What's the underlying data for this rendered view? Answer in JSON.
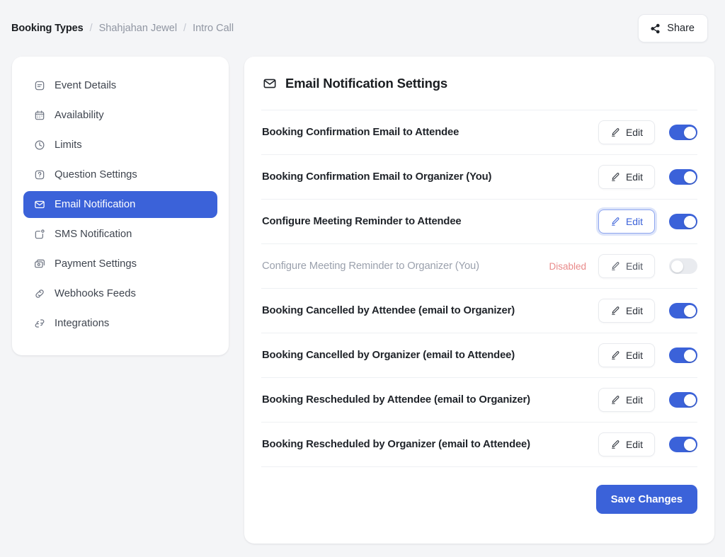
{
  "breadcrumb": {
    "root": "Booking Types",
    "separator": "/",
    "owner": "Shahjahan Jewel",
    "current": "Intro Call"
  },
  "topbar": {
    "share_label": "Share",
    "share_icon": "share-network-icon"
  },
  "sidebar": {
    "items": [
      {
        "label": "Event Details",
        "icon": "event-details-icon",
        "active": false
      },
      {
        "label": "Availability",
        "icon": "calendar-icon",
        "active": false
      },
      {
        "label": "Limits",
        "icon": "clock-icon",
        "active": false
      },
      {
        "label": "Question Settings",
        "icon": "question-square-icon",
        "active": false
      },
      {
        "label": "Email Notification",
        "icon": "envelope-icon",
        "active": true
      },
      {
        "label": "SMS Notification",
        "icon": "sms-bubble-icon",
        "active": false
      },
      {
        "label": "Payment Settings",
        "icon": "payment-card-icon",
        "active": false
      },
      {
        "label": "Webhooks Feeds",
        "icon": "link-icon",
        "active": false
      },
      {
        "label": "Integrations",
        "icon": "integrations-icon",
        "active": false
      }
    ]
  },
  "main": {
    "title": "Email Notification Settings",
    "title_icon": "envelope-icon",
    "edit_label": "Edit",
    "edit_icon": "pencil-icon",
    "disabled_label": "Disabled",
    "save_label": "Save Changes",
    "rows": [
      {
        "label": "Booking Confirmation Email to Attendee",
        "enabled": true,
        "focused": false,
        "disabled": false
      },
      {
        "label": "Booking Confirmation Email to Organizer (You)",
        "enabled": true,
        "focused": false,
        "disabled": false
      },
      {
        "label": "Configure Meeting Reminder to Attendee",
        "enabled": true,
        "focused": true,
        "disabled": false
      },
      {
        "label": "Configure Meeting Reminder to Organizer (You)",
        "enabled": false,
        "focused": false,
        "disabled": true
      },
      {
        "label": "Booking Cancelled by Attendee (email to Organizer)",
        "enabled": true,
        "focused": false,
        "disabled": false
      },
      {
        "label": "Booking Cancelled by Organizer (email to Attendee)",
        "enabled": true,
        "focused": false,
        "disabled": false
      },
      {
        "label": "Booking Rescheduled by Attendee (email to Organizer)",
        "enabled": true,
        "focused": false,
        "disabled": false
      },
      {
        "label": "Booking Rescheduled by Organizer (email to Attendee)",
        "enabled": true,
        "focused": false,
        "disabled": false
      }
    ]
  },
  "colors": {
    "accent": "#3b62d9",
    "page_bg": "#f4f5f7",
    "card_bg": "#ffffff",
    "disabled_text": "#e98a8a",
    "toggle_off": "#e9ebef"
  }
}
